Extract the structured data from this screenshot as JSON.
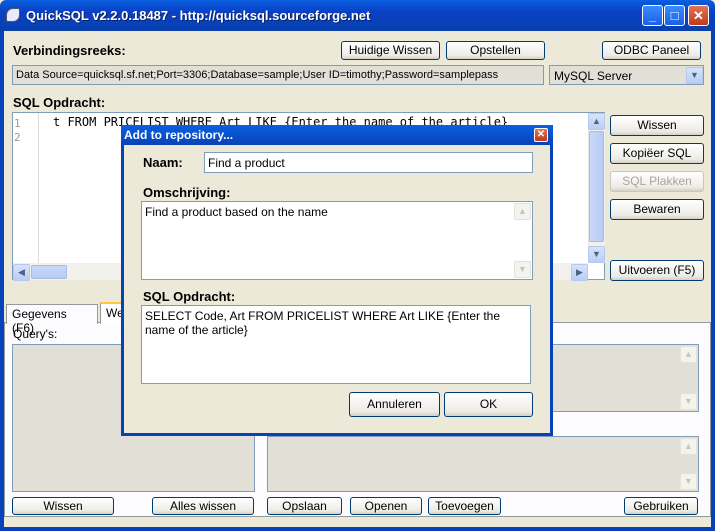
{
  "window": {
    "title": "QuickSQL v2.2.0.18487 - http://quicksql.sourceforge.net",
    "minimize_glyph": "_",
    "maximize_glyph": "□",
    "close_glyph": "✕"
  },
  "connection": {
    "label": "Verbindingsreeks:",
    "clear_current_label": "Huidige Wissen",
    "setup_label": "Opstellen",
    "odbc_label": "ODBC Paneel",
    "connection_string": "Data Source=quicksql.sf.net;Port=3306;Database=sample;User ID=timothy;Password=samplepass",
    "server_type": "MySQL Server"
  },
  "sql": {
    "label": "SQL Opdracht:",
    "line_numbers": [
      "1",
      "2"
    ],
    "line1": "t FROM PRICELIST WHERE Art LIKE {Enter the name of the article}",
    "buttons": {
      "clear": "Wissen",
      "copy": "Kopiëer SQL",
      "paste": "SQL Plakken",
      "save": "Bewaren",
      "execute": "Uitvoeren (F5)"
    }
  },
  "tabs": [
    {
      "label": "Gegevens (F6)"
    },
    {
      "label": "We"
    }
  ],
  "queries": {
    "label": "Query's:"
  },
  "bottom_buttons": {
    "clear": "Wissen",
    "clear_all": "Alles wissen",
    "save": "Opslaan",
    "open": "Openen",
    "add": "Toevoegen",
    "use": "Gebruiken"
  },
  "dialog": {
    "title": "Add to repository...",
    "close_glyph": "✕",
    "name_label": "Naam:",
    "name_value": "Find a product",
    "description_label": "Omschrijving:",
    "description_value": "Find a product based on the name",
    "sql_label": "SQL Opdracht:",
    "sql_value": "SELECT Code, Art FROM PRICELIST WHERE Art LIKE {Enter the name of the article}",
    "cancel_label": "Annuleren",
    "ok_label": "OK"
  }
}
